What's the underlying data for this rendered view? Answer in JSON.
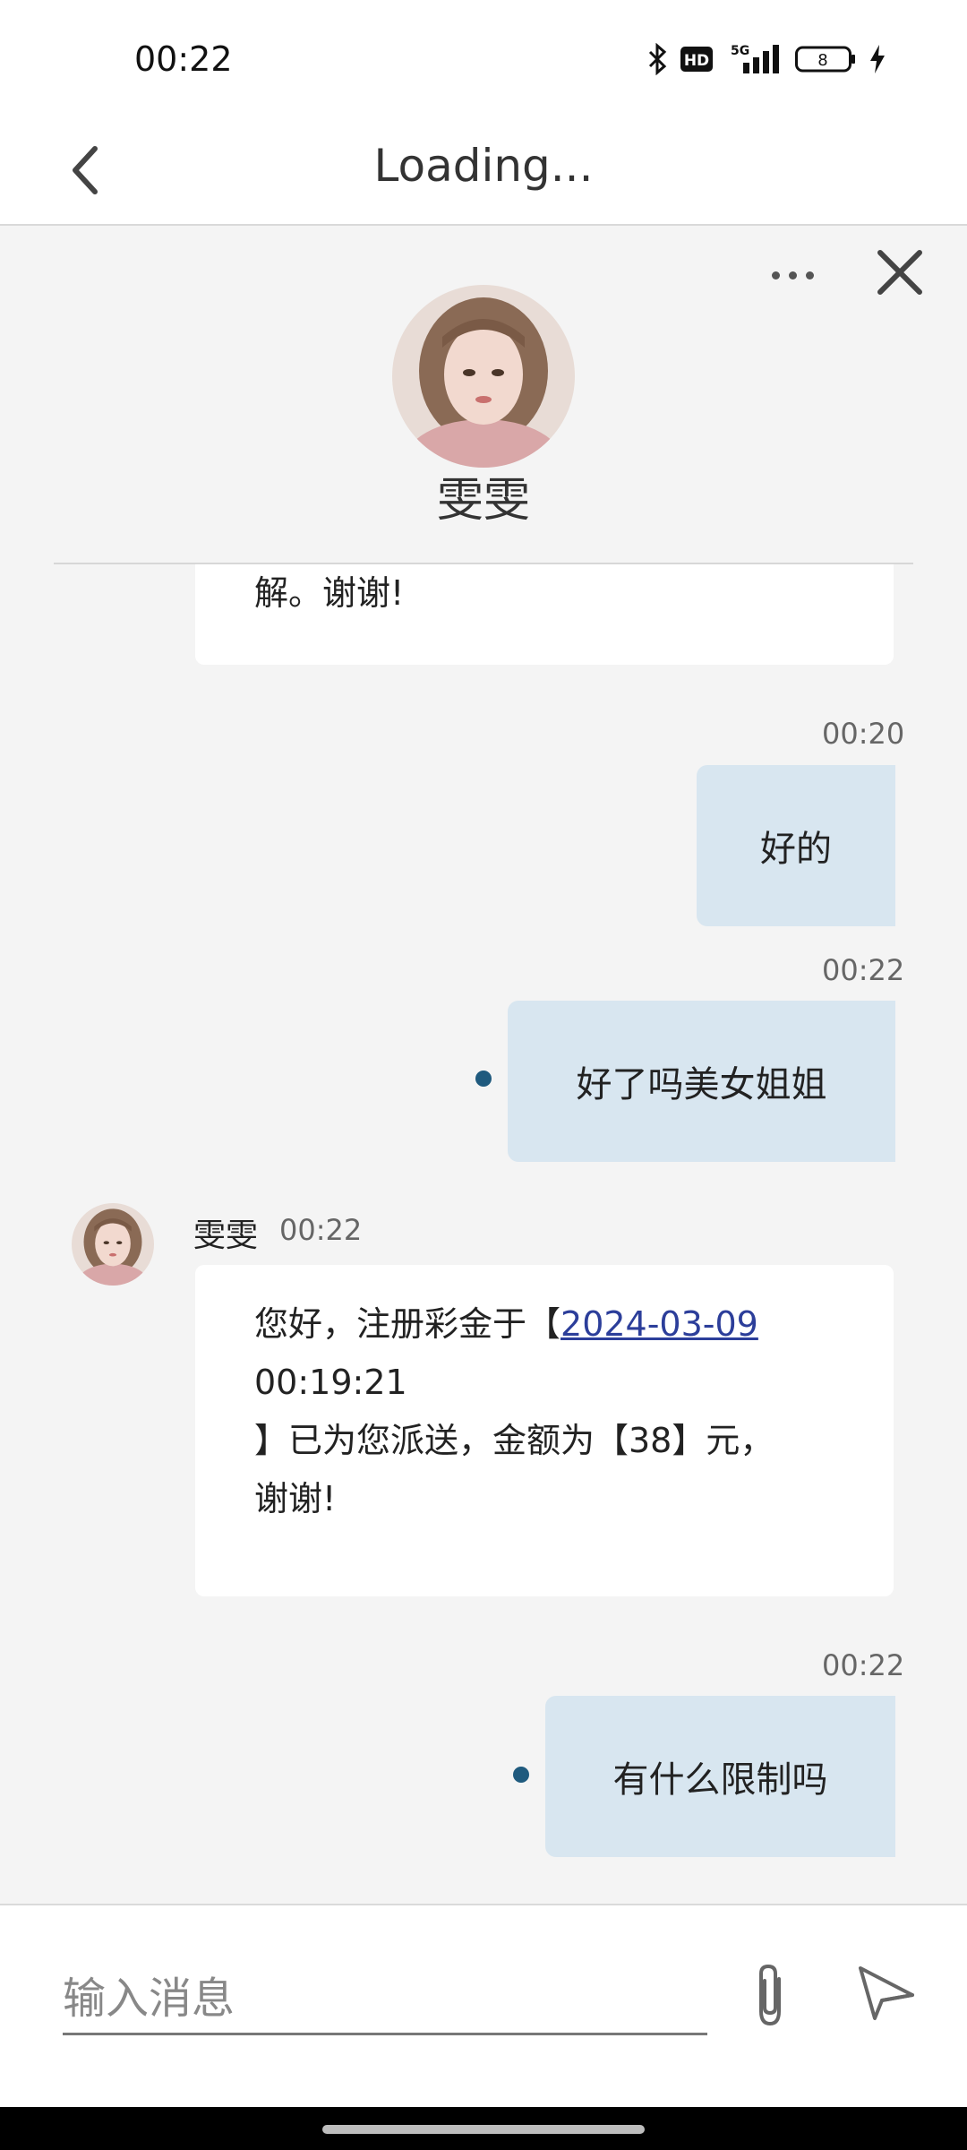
{
  "status_bar": {
    "time": "00:22",
    "battery_level": "8",
    "network": "5G",
    "hd_badge": "HD",
    "icons": [
      "bluetooth-icon",
      "hd-icon",
      "signal-5g-icon",
      "battery-icon",
      "charging-icon"
    ]
  },
  "nav": {
    "title": "Loading..."
  },
  "chat_header": {
    "agent_name": "雯雯"
  },
  "messages": [
    {
      "side": "left",
      "text_tail": "解。谢谢!"
    },
    {
      "side": "right",
      "time": "00:20",
      "text": "好的",
      "unread": false
    },
    {
      "side": "right",
      "time": "00:22",
      "text": "好了吗美女姐姐",
      "unread": true
    },
    {
      "side": "left",
      "sender": "雯雯",
      "time": "00:22",
      "line1_prefix": "您好，注册彩金于【",
      "line1_link": "2024-03-09",
      "line2": "00:19:21",
      "line3": "】已为您派送，金额为【38】元，",
      "line4": "谢谢!"
    },
    {
      "side": "right",
      "time": "00:22",
      "text": "有什么限制吗",
      "unread": true
    }
  ],
  "composer": {
    "placeholder": "输入消息"
  },
  "colors": {
    "user_bubble": "#d8e6f0",
    "agent_bubble": "#ffffff",
    "unread_dot": "#1f5a7e",
    "link": "#2c3e9a"
  }
}
